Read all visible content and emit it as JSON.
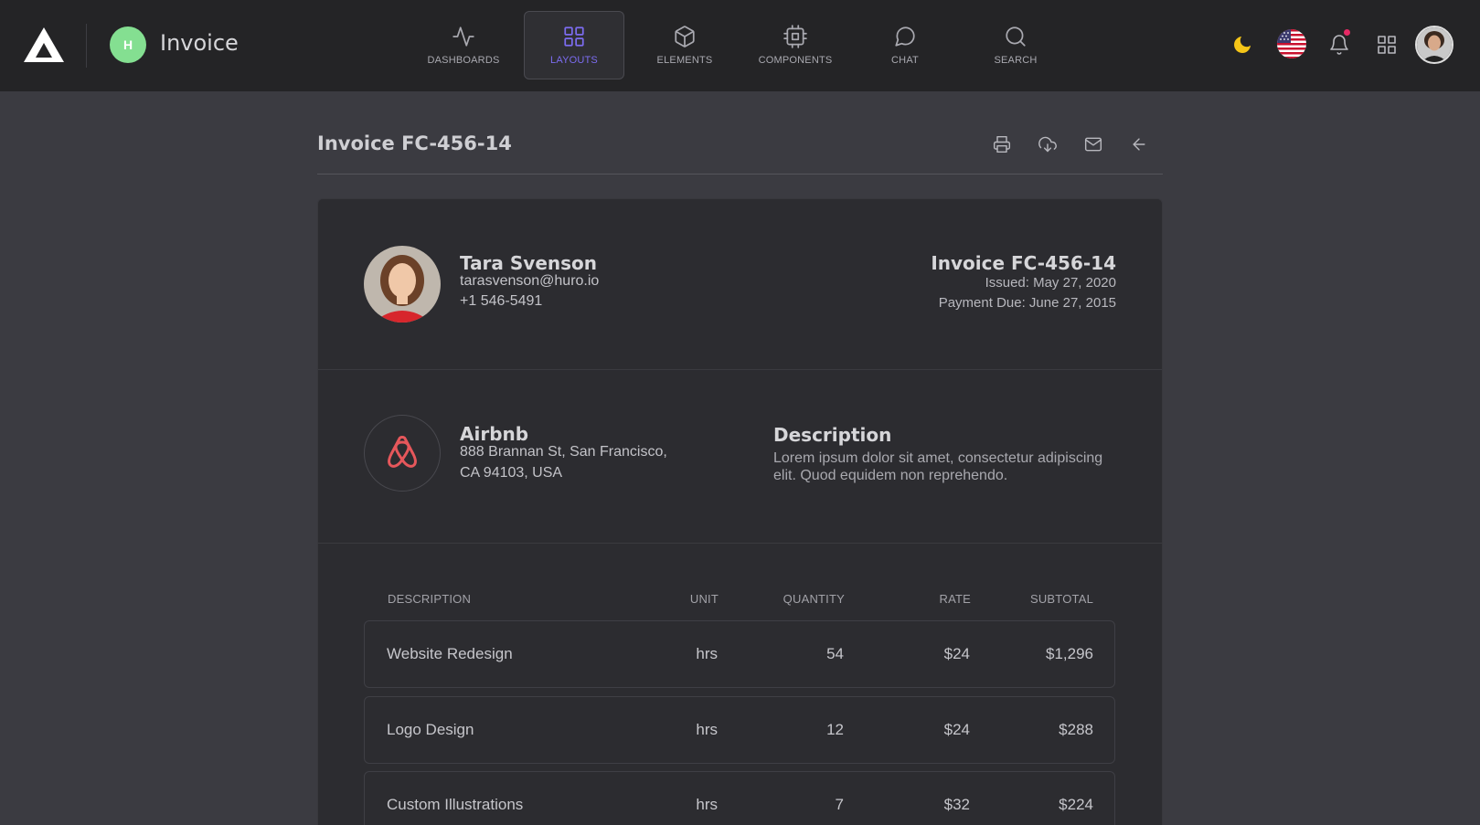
{
  "app": {
    "workspace_initial": "H",
    "workspace_title": "Invoice"
  },
  "nav": [
    {
      "label": "DASHBOARDS",
      "icon": "activity-icon",
      "active": false
    },
    {
      "label": "LAYOUTS",
      "icon": "grid-icon",
      "active": true
    },
    {
      "label": "ELEMENTS",
      "icon": "box-icon",
      "active": false
    },
    {
      "label": "COMPONENTS",
      "icon": "cpu-icon",
      "active": false
    },
    {
      "label": "CHAT",
      "icon": "chat-icon",
      "active": false
    },
    {
      "label": "SEARCH",
      "icon": "search-icon",
      "active": false
    }
  ],
  "colors": {
    "accent": "#7c6cf0",
    "workspace_avatar": "#84df91",
    "notification": "#e62965",
    "theme_moon": "#f5c518",
    "airbnb": "#e6575b"
  },
  "page": {
    "title": "Invoice FC-456-14"
  },
  "customer": {
    "name": "Tara Svenson",
    "email": "tarasvenson@huro.io",
    "phone": "+1 546-5491"
  },
  "invoice": {
    "number": "Invoice FC-456-14",
    "issued": "Issued: May 27, 2020",
    "due": "Payment Due: June 27, 2015"
  },
  "company": {
    "name": "Airbnb",
    "address_line1": "888 Brannan St, San Francisco,",
    "address_line2": "CA 94103, USA"
  },
  "description": {
    "title": "Description",
    "text": "Lorem ipsum dolor sit amet, consectetur adipiscing elit. Quod equidem non reprehendo."
  },
  "table": {
    "headers": {
      "description": "DESCRIPTION",
      "unit": "UNIT",
      "quantity": "QUANTITY",
      "rate": "RATE",
      "subtotal": "SUBTOTAL"
    },
    "rows": [
      {
        "description": "Website Redesign",
        "unit": "hrs",
        "quantity": "54",
        "rate": "$24",
        "subtotal": "$1,296"
      },
      {
        "description": "Logo Design",
        "unit": "hrs",
        "quantity": "12",
        "rate": "$24",
        "subtotal": "$288"
      },
      {
        "description": "Custom Illustrations",
        "unit": "hrs",
        "quantity": "7",
        "rate": "$32",
        "subtotal": "$224"
      }
    ]
  }
}
